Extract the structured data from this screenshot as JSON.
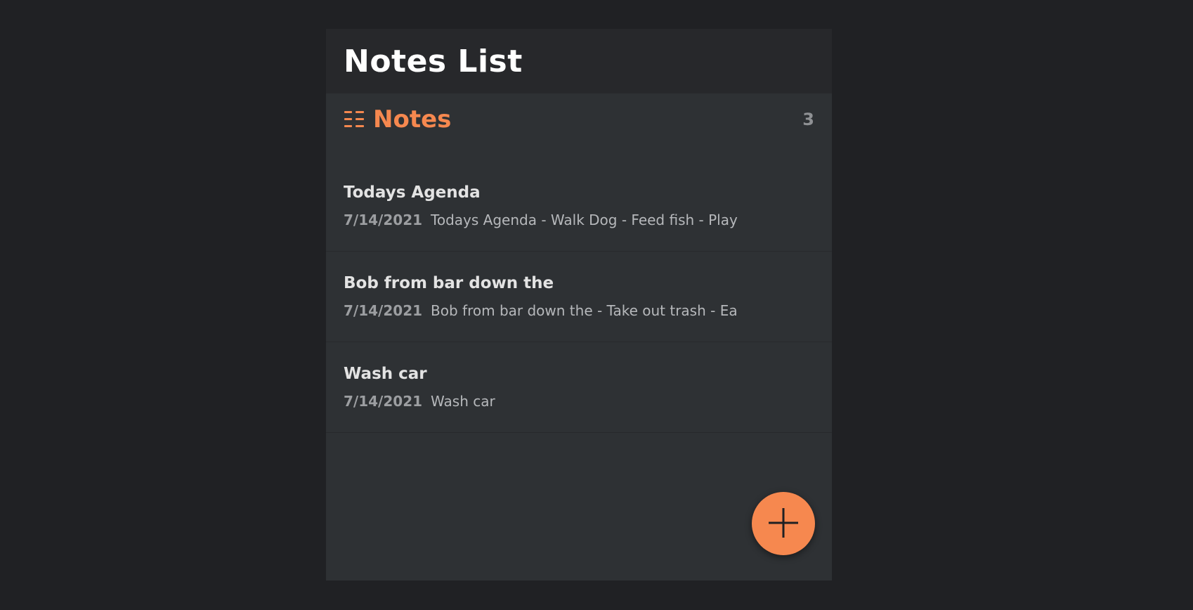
{
  "header": {
    "title": "Notes List"
  },
  "section": {
    "icon": "list-icon",
    "title": "Notes",
    "count": "3",
    "accent_color": "#f6884f"
  },
  "notes": [
    {
      "title": "Todays Agenda",
      "date": "7/14/2021",
      "snippet": "Todays Agenda - Walk Dog - Feed fish - Play"
    },
    {
      "title": "Bob from bar down the",
      "date": "7/14/2021",
      "snippet": "Bob from bar down the - Take out trash - Ea"
    },
    {
      "title": "Wash car",
      "date": "7/14/2021",
      "snippet": "Wash car"
    }
  ],
  "fab": {
    "icon": "plus-icon",
    "color": "#f6884f"
  }
}
